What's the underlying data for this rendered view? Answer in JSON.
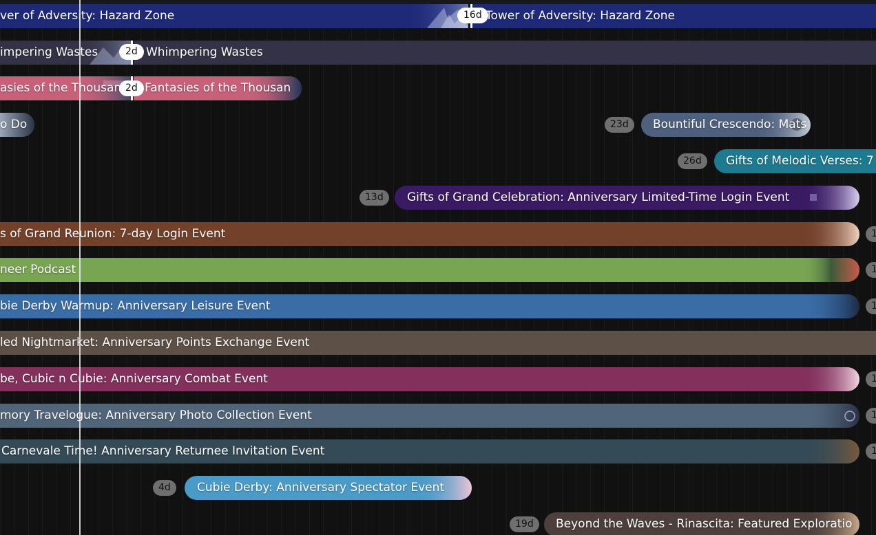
{
  "events": [
    {
      "name": "Tower of Adversity: Hazard Zone",
      "left_text": "ver of Adversity: Hazard Zone",
      "badge": "16d",
      "color": "#1e2a78"
    },
    {
      "name": "Whimpering Wastes",
      "left_text": "impering Wastes",
      "badge": "2d",
      "color": "#343246"
    },
    {
      "name": "Fantasies of the Thousan",
      "left_text": "asies of the Thousan",
      "badge": "2d",
      "color": "#c9607a"
    },
    {
      "name": "Bountiful Crescendo: Mats",
      "left_text": "o Do",
      "badge": "23d",
      "color": "#4e607e"
    },
    {
      "name": "Gifts of Melodic Verses: 7",
      "badge": "26d",
      "color": "#1d7a90"
    },
    {
      "name": "Gifts of Grand Celebration: Anniversary Limited-Time Login Event",
      "badge": "13d",
      "color": "#3a1a63"
    },
    {
      "name": "s of Grand Reunion: 7-day Login Event",
      "badge": "1",
      "color": "#73402a"
    },
    {
      "name": "neer Podcast",
      "badge": "1",
      "color": "#78a552"
    },
    {
      "name": "bie Derby Warmup: Anniversary Leisure Event",
      "badge": "1",
      "color": "#3a6ca6"
    },
    {
      "name": "led Nightmarket: Anniversary Points Exchange Event",
      "color": "#5d5047"
    },
    {
      "name": "be, Cubic n Cubie: Anniversary Combat Event",
      "badge": "1",
      "color": "#83305d"
    },
    {
      "name": "mory Travelogue: Anniversary Photo Collection Event",
      "badge": "1",
      "color": "#51657a"
    },
    {
      "name": "Carnevale Time! Anniversary Returnee Invitation Event",
      "badge": "1",
      "color": "#344a56"
    },
    {
      "name": "Cubie Derby: Anniversary Spectator Event",
      "badge": "4d",
      "color": "#4b9bc8"
    },
    {
      "name": "Beyond the Waves - Rinascita: Featured Exploration",
      "badge": "19d",
      "color": "#4c3f3c"
    }
  ]
}
